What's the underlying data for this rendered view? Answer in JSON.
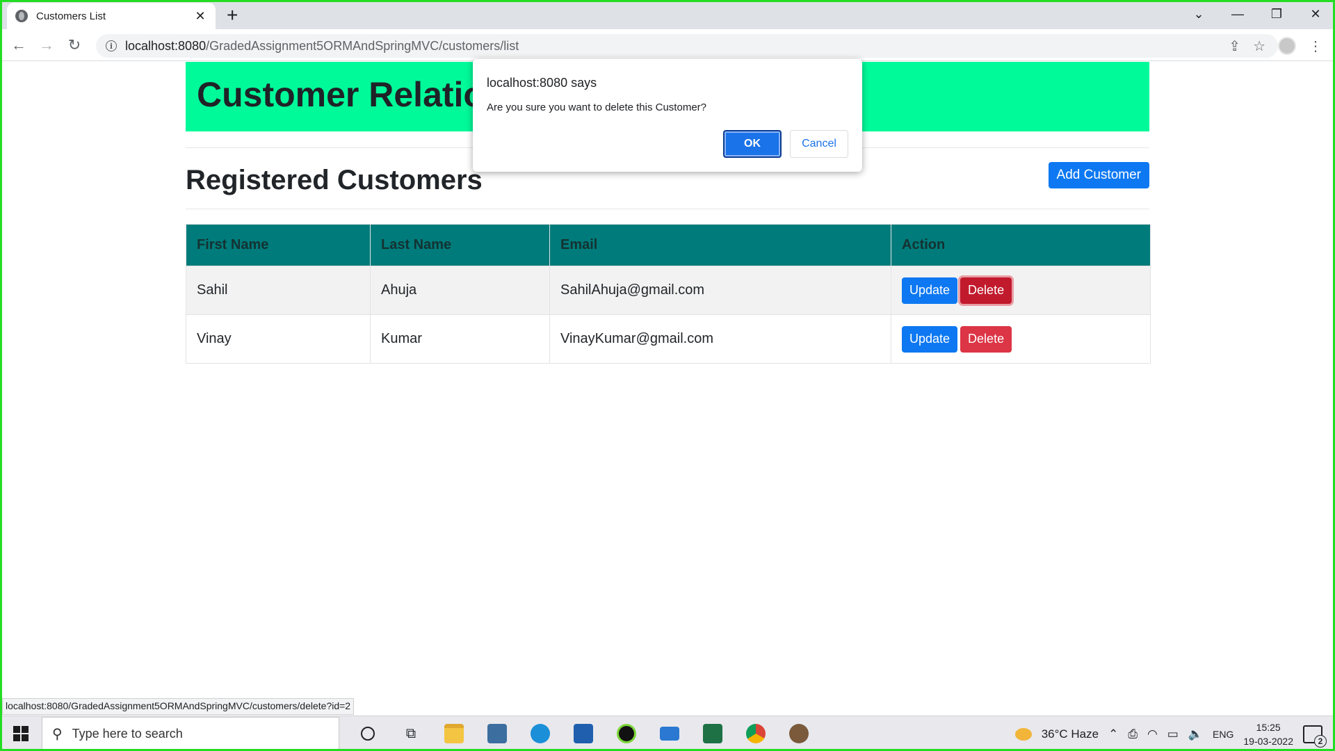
{
  "browser": {
    "tab_title": "Customers List",
    "url_host": "localhost:8080",
    "url_path": "/GradedAssignment5ORMAndSpringMVC/customers/list",
    "status_url": "localhost:8080/GradedAssignment5ORMAndSpringMVC/customers/delete?id=2"
  },
  "page": {
    "banner_title": "Customer Relationship Management",
    "heading": "Registered Customers",
    "add_button": "Add Customer",
    "columns": [
      "First Name",
      "Last Name",
      "Email",
      "Action"
    ],
    "rows": [
      {
        "first": "Sahil",
        "last": "Ahuja",
        "email": "SahilAhuja@gmail.com",
        "update": "Update",
        "delete": "Delete"
      },
      {
        "first": "Vinay",
        "last": "Kumar",
        "email": "VinayKumar@gmail.com",
        "update": "Update",
        "delete": "Delete"
      }
    ]
  },
  "dialog": {
    "title": "localhost:8080 says",
    "message": "Are you sure you want to delete this Customer?",
    "ok": "OK",
    "cancel": "Cancel"
  },
  "taskbar": {
    "search_placeholder": "Type here to search",
    "weather": "36°C  Haze",
    "lang": "ENG",
    "time": "15:25",
    "date": "19-03-2022",
    "notifications": "2"
  },
  "colors": {
    "banner": "#00fa9a",
    "table_header": "#007b7b",
    "primary": "#0d78f2",
    "danger": "#dc3545"
  }
}
